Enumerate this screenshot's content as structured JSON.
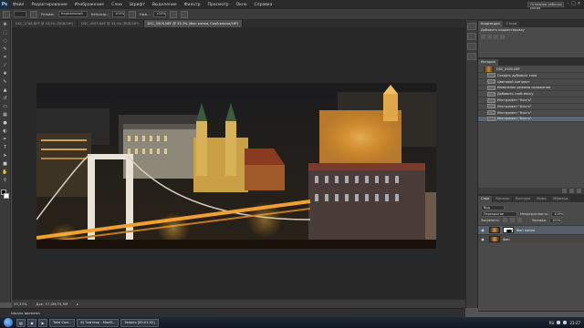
{
  "app": {
    "logo": "Ps"
  },
  "menu": [
    "Файл",
    "Редактирование",
    "Изображение",
    "Слои",
    "Шрифт",
    "Выделение",
    "Фильтр",
    "Просмотр",
    "Окно",
    "Справка"
  ],
  "workspace": "Основная рабочая среда",
  "options_bar": {
    "mode_label": "Режим:",
    "mode_value": "Нормальный",
    "opacity_label": "Непрозр.:",
    "opacity_value": "100%",
    "flow_label": "Наж.:",
    "flow_value": "100%"
  },
  "doc_tabs": [
    {
      "label": "DSC_2768.NEF @ 33,3% (RGB/16*)",
      "active": false
    },
    {
      "label": "DSC_0005.NEF @ 33,3% (RGB/16*)",
      "active": false
    },
    {
      "label": "DSC_0905.NEF @ 33,3% (Фон копия, Слой-маска/16*)",
      "active": true
    }
  ],
  "tools": [
    "move",
    "marquee",
    "lasso",
    "quick-select",
    "crop",
    "eyedropper",
    "healing",
    "brush",
    "clone-stamp",
    "history-brush",
    "eraser",
    "gradient",
    "blur",
    "dodge",
    "pen",
    "type",
    "path-select",
    "shape",
    "hand",
    "zoom"
  ],
  "status_bar": {
    "zoom": "33,33%",
    "doc_size": "Док: 57,0M/75,9M"
  },
  "timeline": {
    "label": "Шкала времени"
  },
  "right_panel": {
    "corrections": {
      "tabs": [
        "Коррекция",
        "Стили"
      ],
      "title": "Добавить корректировку"
    },
    "history": {
      "tab": "История",
      "snapshot": "DSC_0905.NEF",
      "items": [
        {
          "label": "Создать дубликат слоя",
          "selected": false
        },
        {
          "label": "Цветовой контраст",
          "selected": false
        },
        {
          "label": "Изменение режима наложения",
          "selected": false
        },
        {
          "label": "Добавить слой-маску",
          "selected": false
        },
        {
          "label": "Инструмент \"Кисть\"",
          "selected": false
        },
        {
          "label": "Инструмент \"Кисть\"",
          "selected": false
        },
        {
          "label": "Инструмент \"Кисть\"",
          "selected": false
        },
        {
          "label": "Инструмент \"Кисть\"",
          "selected": true
        }
      ]
    },
    "layers": {
      "tabs": [
        "Слои",
        "Каналы",
        "Контуры",
        "Инфо",
        "Образцы"
      ],
      "kind_label": "Вид",
      "blend_mode": "Перекрытие",
      "opacity_label": "Непрозрачность:",
      "opacity_value": "100%",
      "lock_label": "Закрепить:",
      "fill_label": "Заливка:",
      "fill_value": "100%",
      "layer_list": [
        {
          "name": "Фон копия",
          "selected": true,
          "has_mask": true
        },
        {
          "name": "Фон",
          "selected": false,
          "has_mask": false
        }
      ]
    }
  },
  "taskbar": {
    "buttons": [
      "Total Сом...",
      "6) Тамтеор - Mozill...",
      "Запись [00:01:52]"
    ],
    "clock": "23:27",
    "lang": "RU"
  }
}
